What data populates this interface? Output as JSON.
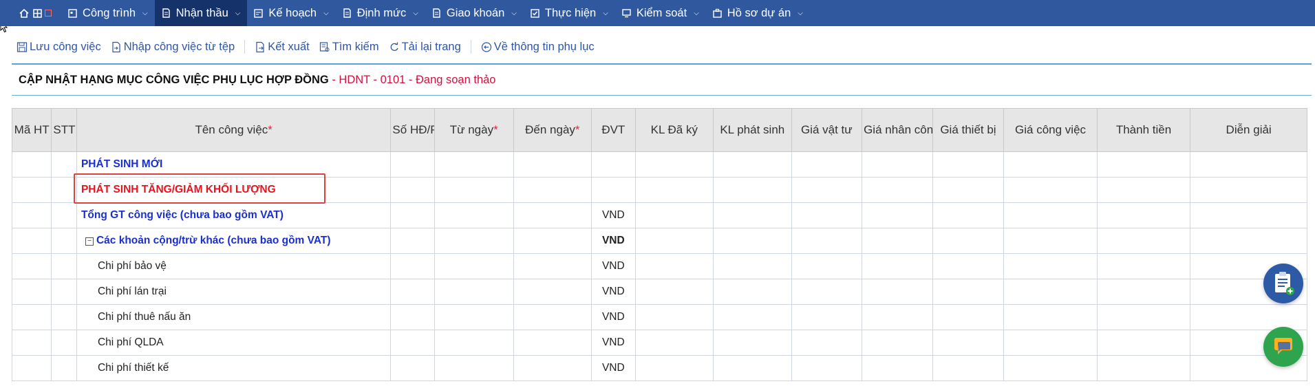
{
  "nav": {
    "items": [
      {
        "label": "Công trình",
        "icon": "building-icon",
        "active": false
      },
      {
        "label": "Nhận thầu",
        "icon": "document-icon",
        "active": true
      },
      {
        "label": "Kế hoạch",
        "icon": "plan-icon",
        "active": false
      },
      {
        "label": "Định mức",
        "icon": "document-icon",
        "active": false
      },
      {
        "label": "Giao khoán",
        "icon": "document-icon",
        "active": false
      },
      {
        "label": "Thực hiện",
        "icon": "checkbox-icon",
        "active": false
      },
      {
        "label": "Kiểm soát",
        "icon": "monitor-icon",
        "active": false
      },
      {
        "label": "Hồ sơ dự án",
        "icon": "briefcase-icon",
        "active": false
      }
    ]
  },
  "toolbar": {
    "save": "Lưu công việc",
    "import": "Nhập công việc từ tệp",
    "export": "Kết xuất",
    "search": "Tìm kiếm",
    "reload": "Tải lại trang",
    "back": "Về thông tin phụ lục"
  },
  "page": {
    "title_main": "CẬP NHẬT HẠNG MỤC CÔNG VIỆC PHỤ LỤC HỢP ĐỒNG",
    "title_rest": " - HDNT - 0101 - Đang soạn thảo"
  },
  "grid": {
    "columns": {
      "ma_ht": "Mã HT",
      "stt": "STT",
      "ten": "Tên công việc",
      "so_hd": "Số HĐ/P",
      "tu_ngay": "Từ ngày",
      "den_ngay": "Đến ngày",
      "dvt": "ĐVT",
      "kl_da_ky": "KL Đã ký",
      "kl_phat_sinh": "KL phát sinh",
      "gia_vat_tu": "Giá vật tư",
      "gia_nhan_cong": "Giá nhân công",
      "gia_thiet_bi": "Giá thiết bị",
      "gia_cong_viec": "Giá công việc",
      "thanh_tien": "Thành tiền",
      "dien_giai": "Diễn giải"
    },
    "required_mark": "*",
    "rows": [
      {
        "name": "PHÁT SINH MỚI",
        "dvt": ""
      },
      {
        "name": "PHÁT SINH TĂNG/GIẢM KHỐI LƯỢNG",
        "dvt": ""
      },
      {
        "name": "Tổng GT công việc (chưa bao gồm VAT)",
        "dvt": "VND"
      },
      {
        "name": "Các khoản cộng/trừ khác (chưa bao gồm VAT)",
        "dvt": "VND",
        "collapse": "−"
      },
      {
        "name": "Chi phí bảo vệ",
        "dvt": "VND"
      },
      {
        "name": "Chi phí lán trại",
        "dvt": "VND"
      },
      {
        "name": "Chi phí thuê nấu ăn",
        "dvt": "VND"
      },
      {
        "name": "Chi phí QLDA",
        "dvt": "VND"
      },
      {
        "name": "Chi phí thiết kế",
        "dvt": "VND"
      }
    ]
  },
  "colors": {
    "nav_bg": "#30589f",
    "nav_active": "#16326b",
    "link_blue": "#2f55a4",
    "section_blue": "#1a2fd0",
    "section_red": "#e8131c",
    "status_red": "#d1113d",
    "fab_blue": "#2c5aa7",
    "fab_green": "#2ea44f"
  }
}
